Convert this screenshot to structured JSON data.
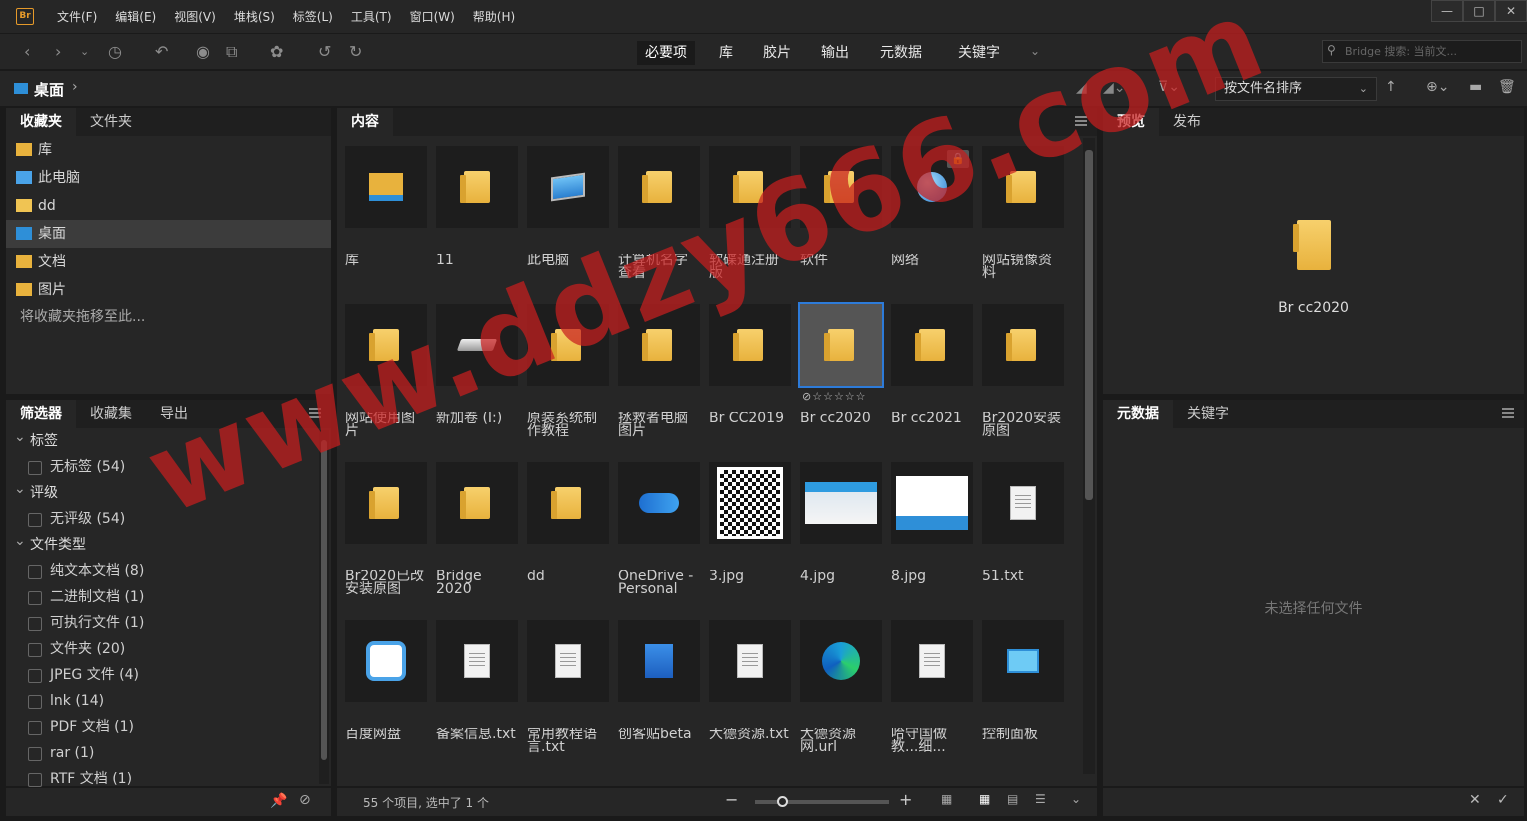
{
  "app": {
    "logo": "Br"
  },
  "menu": [
    "文件(F)",
    "编辑(E)",
    "视图(V)",
    "堆栈(S)",
    "标签(L)",
    "工具(T)",
    "窗口(W)",
    "帮助(H)"
  ],
  "window_controls": [
    "—",
    "□",
    "✕"
  ],
  "workspaces": [
    "必要项",
    "库",
    "胶片",
    "输出",
    "元数据",
    "关键字"
  ],
  "search": {
    "placeholder": "Bridge 搜索: 当前文..."
  },
  "path": {
    "current": "桌面"
  },
  "sort": {
    "label": "按文件名排序"
  },
  "left_top_tabs": [
    "收藏夹",
    "文件夹"
  ],
  "favorites": [
    {
      "label": "库",
      "icon": "library-icon"
    },
    {
      "label": "此电脑",
      "icon": "computer-icon"
    },
    {
      "label": "dd",
      "icon": "folder-icon"
    },
    {
      "label": "桌面",
      "icon": "desktop-icon"
    },
    {
      "label": "文档",
      "icon": "documents-icon"
    },
    {
      "label": "图片",
      "icon": "pictures-icon"
    }
  ],
  "favorites_hint": "将收藏夹拖移至此...",
  "left_bottom_tabs": [
    "筛选器",
    "收藏集",
    "导出"
  ],
  "filters": {
    "groups": [
      {
        "label": "标签",
        "items": [
          "无标签 (54)"
        ]
      },
      {
        "label": "评级",
        "items": [
          "无评级 (54)"
        ]
      },
      {
        "label": "文件类型",
        "items": [
          "纯文本文档 (8)",
          "二进制文档 (1)",
          "可执行文件 (1)",
          "文件夹 (20)",
          "JPEG 文件 (4)",
          "lnk (14)",
          "PDF 文档 (1)",
          "rar (1)",
          "RTF 文档 (1)"
        ]
      }
    ]
  },
  "content_tab": "内容",
  "items": [
    {
      "name": "库",
      "type": "library"
    },
    {
      "name": "11",
      "type": "folder"
    },
    {
      "name": "此电脑",
      "type": "computer"
    },
    {
      "name": "计算机名字查看",
      "type": "folder"
    },
    {
      "name": "软碟通注册版",
      "type": "folder"
    },
    {
      "name": "软件",
      "type": "folder"
    },
    {
      "name": "网络",
      "type": "network"
    },
    {
      "name": "网站镜像资料",
      "type": "folder"
    },
    {
      "name": "网站使用图片",
      "type": "folder"
    },
    {
      "name": "新加卷 (I:)",
      "type": "drive"
    },
    {
      "name": "原装系统制作教程",
      "type": "folder"
    },
    {
      "name": "拯救者电脑图片",
      "type": "folder"
    },
    {
      "name": "Br CC2019",
      "type": "folder"
    },
    {
      "name": "Br cc2020",
      "type": "folder",
      "selected": true
    },
    {
      "name": "Br cc2021",
      "type": "folder"
    },
    {
      "name": "Br2020安装原图",
      "type": "folder"
    },
    {
      "name": "Br2020已改安装原图",
      "type": "folder"
    },
    {
      "name": "Bridge 2020",
      "type": "folder"
    },
    {
      "name": "dd",
      "type": "folder"
    },
    {
      "name": "OneDrive - Personal",
      "type": "onedrive"
    },
    {
      "name": "3.jpg",
      "type": "qr"
    },
    {
      "name": "4.jpg",
      "type": "image"
    },
    {
      "name": "8.jpg",
      "type": "logo"
    },
    {
      "name": "51.txt",
      "type": "doc"
    },
    {
      "name": "百度网盘",
      "type": "baidu"
    },
    {
      "name": "备案信息.txt",
      "type": "doc"
    },
    {
      "name": "常用教程语言.txt",
      "type": "doc"
    },
    {
      "name": "创客贴beta",
      "type": "app"
    },
    {
      "name": "大德资源.txt",
      "type": "doc"
    },
    {
      "name": "大德资源网.url",
      "type": "edge"
    },
    {
      "name": "哈守国做教...细...",
      "type": "doc"
    },
    {
      "name": "控制面板",
      "type": "control"
    }
  ],
  "status": {
    "text": "55 个项目, 选中了 1 个",
    "zoom_fraction": 0.2
  },
  "preview_tabs": [
    "预览",
    "发布"
  ],
  "preview": {
    "name": "Br cc2020"
  },
  "meta_tabs": [
    "元数据",
    "关键字"
  ],
  "meta_empty": "未选择任何文件",
  "watermark": "www.ddzy666.com"
}
